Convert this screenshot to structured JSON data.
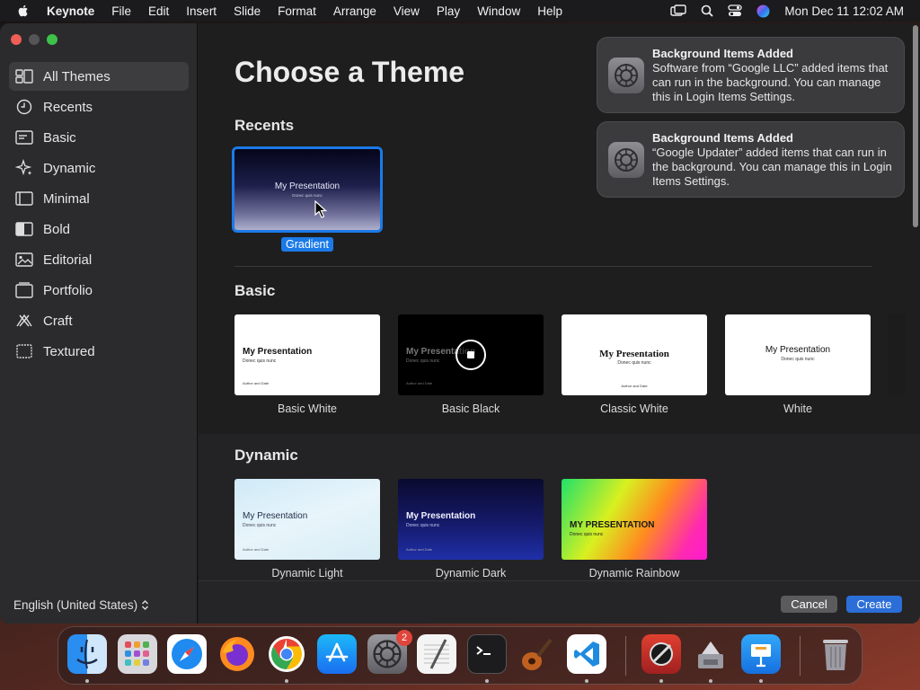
{
  "menubar": {
    "app_name": "Keynote",
    "items": [
      "File",
      "Edit",
      "Insert",
      "Slide",
      "Format",
      "Arrange",
      "View",
      "Play",
      "Window",
      "Help"
    ],
    "clock": "Mon Dec 11  12:02 AM"
  },
  "sidebar": {
    "items": [
      {
        "label": "All Themes",
        "icon": "all-themes-icon"
      },
      {
        "label": "Recents",
        "icon": "clock-icon"
      },
      {
        "label": "Basic",
        "icon": "basic-icon"
      },
      {
        "label": "Dynamic",
        "icon": "sparkle-icon"
      },
      {
        "label": "Minimal",
        "icon": "minimal-icon"
      },
      {
        "label": "Bold",
        "icon": "bold-icon"
      },
      {
        "label": "Editorial",
        "icon": "image-icon"
      },
      {
        "label": "Portfolio",
        "icon": "portfolio-icon"
      },
      {
        "label": "Craft",
        "icon": "craft-icon"
      },
      {
        "label": "Textured",
        "icon": "textured-icon"
      }
    ],
    "language": "English (United States)"
  },
  "main": {
    "title": "Choose a Theme",
    "recents": {
      "heading": "Recents",
      "themes": [
        {
          "label": "Gradient",
          "slide_title": "My Presentation",
          "slide_subtitle": "Donec quis nunc"
        }
      ]
    },
    "basic": {
      "heading": "Basic",
      "themes": [
        {
          "label": "Basic White",
          "slide_title": "My Presentation",
          "slide_subtitle": "Donec quis nunc",
          "footer": "Author and Date"
        },
        {
          "label": "Basic Black",
          "slide_title": "My Presentation",
          "slide_subtitle": "Donec quis nunc",
          "footer": "Author and Date"
        },
        {
          "label": "Classic White",
          "slide_title": "My Presentation",
          "slide_subtitle": "Donec quis nunc",
          "footer": "Author and Date"
        },
        {
          "label": "White",
          "slide_title": "My Presentation",
          "slide_subtitle": "Donec quis nunc"
        }
      ]
    },
    "dynamic": {
      "heading": "Dynamic",
      "themes": [
        {
          "label": "Dynamic Light",
          "slide_title": "My Presentation",
          "slide_subtitle": "Donec quis nunc",
          "footer": "Author and Date"
        },
        {
          "label": "Dynamic Dark",
          "slide_title": "My Presentation",
          "slide_subtitle": "Donec quis nunc",
          "footer": "Author and Date"
        },
        {
          "label": "Dynamic Rainbow",
          "slide_title": "MY PRESENTATION",
          "slide_subtitle": "Donec quis nunc"
        }
      ]
    }
  },
  "footer": {
    "cancel": "Cancel",
    "create": "Create"
  },
  "notifications": [
    {
      "title": "Background Items Added",
      "body": "Software from “Google LLC” added items that can run in the background. You can manage this in Login Items Settings."
    },
    {
      "title": "Background Items Added",
      "body": "“Google Updater” added items that can run in the background. You can manage this in Login Items Settings."
    }
  ],
  "dock": {
    "settings_badge": "2",
    "apps": [
      "finder-icon",
      "launchpad-icon",
      "safari-icon",
      "firefox-icon",
      "chrome-icon",
      "app-store-icon",
      "system-settings-icon",
      "textedit-icon",
      "terminal-icon",
      "garageband-icon",
      "vscode-icon",
      "instruments-icon",
      "utility-icon",
      "keynote-icon",
      "trash-icon"
    ]
  },
  "colors": {
    "accent": "#2c6ed8",
    "selection": "#1b7ae8"
  }
}
